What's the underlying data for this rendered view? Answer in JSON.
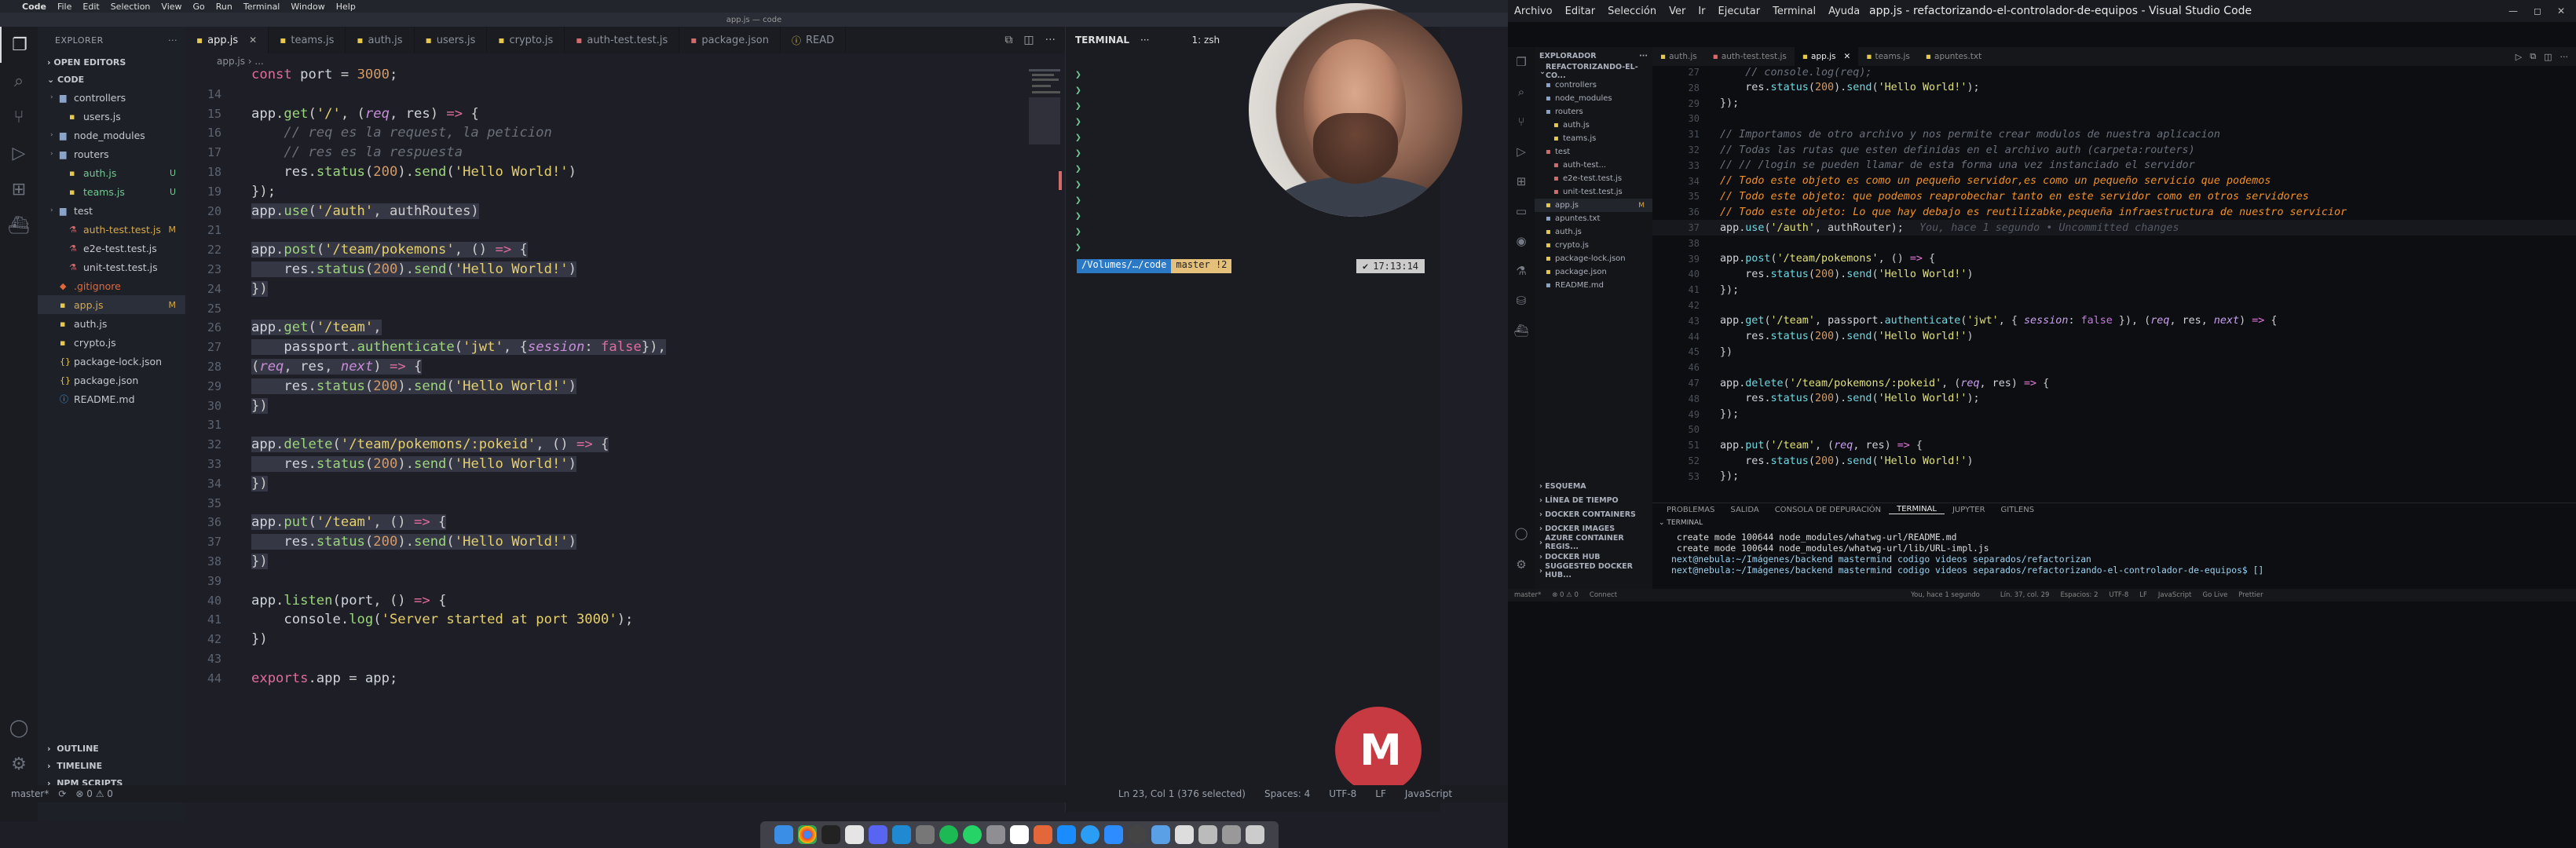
{
  "left": {
    "mac_menubar": [
      "Code",
      "File",
      "Edit",
      "Selection",
      "View",
      "Go",
      "Run",
      "Terminal",
      "Window",
      "Help"
    ],
    "window_title": "app.js — code",
    "explorer_title": "EXPLORER",
    "sections": {
      "open_editors": "OPEN EDITORS",
      "code": "CODE",
      "outline": "OUTLINE",
      "timeline": "TIMELINE",
      "npm_scripts": "NPM SCRIPTS"
    },
    "tree": [
      {
        "label": "controllers",
        "kind": "folder",
        "depth": 1,
        "badge": ""
      },
      {
        "label": "users.js",
        "kind": "js",
        "depth": 2,
        "badge": ""
      },
      {
        "label": "node_modules",
        "kind": "folder",
        "depth": 1,
        "badge": ""
      },
      {
        "label": "routers",
        "kind": "folder",
        "depth": 1,
        "badge": ""
      },
      {
        "label": "auth.js",
        "kind": "js",
        "depth": 2,
        "badge": "U"
      },
      {
        "label": "teams.js",
        "kind": "js",
        "depth": 2,
        "badge": "U"
      },
      {
        "label": "test",
        "kind": "folder",
        "depth": 1,
        "badge": ""
      },
      {
        "label": "auth-test.test.js",
        "kind": "test",
        "depth": 2,
        "badge": "M"
      },
      {
        "label": "e2e-test.test.js",
        "kind": "test",
        "depth": 2,
        "badge": ""
      },
      {
        "label": "unit-test.test.js",
        "kind": "test",
        "depth": 2,
        "badge": ""
      },
      {
        "label": ".gitignore",
        "kind": "git",
        "depth": 1,
        "badge": ""
      },
      {
        "label": "app.js",
        "kind": "js",
        "depth": 1,
        "badge": "M"
      },
      {
        "label": "auth.js",
        "kind": "js",
        "depth": 1,
        "badge": ""
      },
      {
        "label": "crypto.js",
        "kind": "js",
        "depth": 1,
        "badge": ""
      },
      {
        "label": "package-lock.json",
        "kind": "json",
        "depth": 1,
        "badge": ""
      },
      {
        "label": "package.json",
        "kind": "json",
        "depth": 1,
        "badge": ""
      },
      {
        "label": "README.md",
        "kind": "md",
        "depth": 1,
        "badge": ""
      }
    ],
    "tabs": [
      "app.js",
      "teams.js",
      "auth.js",
      "users.js",
      "crypto.js",
      "auth-test.test.js",
      "package.json",
      "READ"
    ],
    "breadcrumb": "app.js  ›  ...",
    "code_lines": [
      {
        "n": "",
        "text": "const port = 3000;"
      },
      {
        "n": "14",
        "text": ""
      },
      {
        "n": "15",
        "text": "app.get('/', (req, res) => {"
      },
      {
        "n": "16",
        "text": "    // req es la request, la peticion"
      },
      {
        "n": "17",
        "text": "    // res es la respuesta"
      },
      {
        "n": "18",
        "text": "    res.status(200).send('Hello World!')"
      },
      {
        "n": "19",
        "text": "});"
      },
      {
        "n": "20",
        "text": "app.use('/auth', authRoutes)"
      },
      {
        "n": "21",
        "text": ""
      },
      {
        "n": "22",
        "text": "app.post('/team/pokemons', () => {"
      },
      {
        "n": "23",
        "text": "    res.status(200).send('Hello World!')"
      },
      {
        "n": "24",
        "text": "})"
      },
      {
        "n": "25",
        "text": ""
      },
      {
        "n": "26",
        "text": "app.get('/team',"
      },
      {
        "n": "27",
        "text": "    passport.authenticate('jwt', {session: false}),"
      },
      {
        "n": "28",
        "text": "(req, res, next) => {"
      },
      {
        "n": "29",
        "text": "    res.status(200).send('Hello World!')"
      },
      {
        "n": "30",
        "text": "})"
      },
      {
        "n": "31",
        "text": ""
      },
      {
        "n": "32",
        "text": "app.delete('/team/pokemons/:pokeid', () => {"
      },
      {
        "n": "33",
        "text": "    res.status(200).send('Hello World!')"
      },
      {
        "n": "34",
        "text": "})"
      },
      {
        "n": "35",
        "text": ""
      },
      {
        "n": "36",
        "text": "app.put('/team', () => {"
      },
      {
        "n": "37",
        "text": "    res.status(200).send('Hello World!')"
      },
      {
        "n": "38",
        "text": "})"
      },
      {
        "n": "39",
        "text": ""
      },
      {
        "n": "40",
        "text": "app.listen(port, () => {"
      },
      {
        "n": "41",
        "text": "    console.log('Server started at port 3000');"
      },
      {
        "n": "42",
        "text": "})"
      },
      {
        "n": "43",
        "text": ""
      },
      {
        "n": "44",
        "text": "exports.app = app;"
      }
    ],
    "terminal": {
      "title": "TERMINAL",
      "shell": "1: zsh",
      "ps1_path": "/Volumes/…/code",
      "ps1_branch": "master !2",
      "clock": "17:13:14"
    },
    "statusbar": {
      "branch": "master*",
      "problems": "⊗ 0  ⚠ 0",
      "position": "Ln 23, Col 1 (376 selected)",
      "spaces": "Spaces: 4",
      "encoding": "UTF-8",
      "eol": "LF",
      "language": "JavaScript"
    }
  },
  "right": {
    "menu": [
      "Archivo",
      "Editar",
      "Selección",
      "Ver",
      "Ir",
      "Ejecutar",
      "Terminal",
      "Ayuda"
    ],
    "title": "app.js - refactorizando-el-controlador-de-equipos - Visual Studio Code",
    "explorer_title": "EXPLORADOR",
    "project": "REFACTORIZANDO-EL-CO...",
    "tree": [
      {
        "label": "controllers",
        "badge": ""
      },
      {
        "label": "node_modules",
        "badge": ""
      },
      {
        "label": "routers",
        "badge": ""
      },
      {
        "label": "auth.js",
        "badge": ""
      },
      {
        "label": "teams.js",
        "badge": ""
      },
      {
        "label": "test",
        "badge": ""
      },
      {
        "label": "auth-test...",
        "badge": ""
      },
      {
        "label": "e2e-test.test.js",
        "badge": ""
      },
      {
        "label": "unit-test.test.js",
        "badge": ""
      },
      {
        "label": "app.js",
        "badge": "M"
      },
      {
        "label": "apuntes.txt",
        "badge": ""
      },
      {
        "label": "auth.js",
        "badge": ""
      },
      {
        "label": "crypto.js",
        "badge": ""
      },
      {
        "label": "package-lock.json",
        "badge": ""
      },
      {
        "label": "package.json",
        "badge": ""
      },
      {
        "label": "README.md",
        "badge": ""
      }
    ],
    "sections": [
      "ESQUEMA",
      "LÍNEA DE TIEMPO",
      "DOCKER CONTAINERS",
      "DOCKER IMAGES",
      "AZURE CONTAINER REGIS...",
      "DOCKER HUB",
      "SUGGESTED DOCKER HUB..."
    ],
    "tabs": [
      "auth.js",
      "auth-test.test.js",
      "app.js",
      "teams.js",
      "apuntes.txt"
    ],
    "breadcrumb": "app.js > ...",
    "code_lines": [
      {
        "n": "27",
        "text": "    // console.log(req);"
      },
      {
        "n": "28",
        "text": "    res.status(200).send('Hello World!');"
      },
      {
        "n": "29",
        "text": "});"
      },
      {
        "n": "30",
        "text": ""
      },
      {
        "n": "31",
        "text": "// Importamos de otro archivo y nos permite crear modulos de nuestra aplicacion"
      },
      {
        "n": "32",
        "text": "// Todas las rutas que esten definidas en el archivo auth (carpeta:routers)"
      },
      {
        "n": "33",
        "text": "// // /login se pueden llamar de esta forma una vez instanciado el servidor"
      },
      {
        "n": "34",
        "text": "// Todo este objeto es como un pequeño servidor,es como un pequeño servicio que podemos"
      },
      {
        "n": "35",
        "text": "// Todo este objeto: que podemos reaprobechar tanto en este servidor como en otros servidores"
      },
      {
        "n": "36",
        "text": "// Todo este objeto: Lo que hay debajo es reutilizabke,pequeña infraestructura de nuestro servicior"
      },
      {
        "n": "37",
        "text": "app.use('/auth', authRouter);"
      },
      {
        "n": "38",
        "text": ""
      },
      {
        "n": "39",
        "text": "app.post('/team/pokemons', () => {"
      },
      {
        "n": "40",
        "text": "    res.status(200).send('Hello World!')"
      },
      {
        "n": "41",
        "text": "});"
      },
      {
        "n": "42",
        "text": ""
      },
      {
        "n": "43",
        "text": "app.get('/team', passport.authenticate('jwt', { session: false }), (req, res, next) => {"
      },
      {
        "n": "44",
        "text": "    res.status(200).send('Hello World!')"
      },
      {
        "n": "45",
        "text": "})"
      },
      {
        "n": "46",
        "text": ""
      },
      {
        "n": "47",
        "text": "app.delete('/team/pokemons/:pokeid', (req, res) => {"
      },
      {
        "n": "48",
        "text": "    res.status(200).send('Hello World!');"
      },
      {
        "n": "49",
        "text": "});"
      },
      {
        "n": "50",
        "text": ""
      },
      {
        "n": "51",
        "text": "app.put('/team', (req, res) => {"
      },
      {
        "n": "52",
        "text": "    res.status(200).send('Hello World!')"
      },
      {
        "n": "53",
        "text": "});"
      }
    ],
    "blame": "You, hace 1 segundo • Uncommitted changes",
    "panel_tabs": [
      "PROBLEMAS",
      "SALIDA",
      "CONSOLA DE DEPURACIÓN",
      "TERMINAL",
      "JUPYTER",
      "GITLENS"
    ],
    "terminal_lines": [
      " create mode 100644 node_modules/whatwg-url/README.md",
      " create mode 100644 node_modules/whatwg-url/lib/URL-impl.js",
      "next@nebula:~/Imágenes/backend mastermind codigo videos separados/refactorizan",
      "next@nebula:~/Imágenes/backend mastermind codigo videos separados/refactorizando-el-controlador-de-equipos$ []"
    ],
    "terminal_label": "TERMINAL",
    "statusbar": [
      "master*",
      "⊗ 0 ⚠ 0",
      "Connect",
      "You, hace 1 segundo",
      "Lín. 37, col. 29",
      "Espacios: 2",
      "UTF-8",
      "LF",
      "JavaScript",
      "Go Live",
      "Prettier"
    ]
  }
}
